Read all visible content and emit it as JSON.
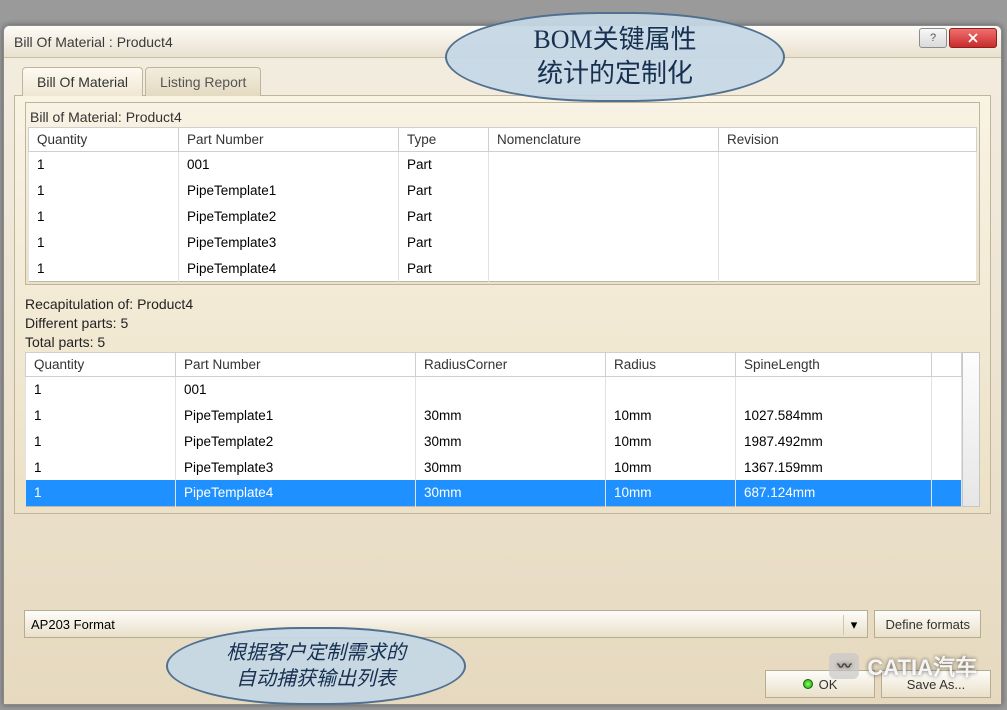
{
  "window": {
    "title": "Bill Of Material : Product4"
  },
  "tabs": {
    "bom": "Bill Of Material",
    "listing": "Listing Report"
  },
  "bom": {
    "section_title": "Bill of Material: Product4",
    "headers": {
      "qty": "Quantity",
      "part": "Part Number",
      "type": "Type",
      "nomen": "Nomenclature",
      "rev": "Revision"
    },
    "rows": [
      {
        "qty": "1",
        "part": "001",
        "type": "Part",
        "nomen": "",
        "rev": ""
      },
      {
        "qty": "1",
        "part": "PipeTemplate1",
        "type": "Part",
        "nomen": "",
        "rev": ""
      },
      {
        "qty": "1",
        "part": "PipeTemplate2",
        "type": "Part",
        "nomen": "",
        "rev": ""
      },
      {
        "qty": "1",
        "part": "PipeTemplate3",
        "type": "Part",
        "nomen": "",
        "rev": ""
      },
      {
        "qty": "1",
        "part": "PipeTemplate4",
        "type": "Part",
        "nomen": "",
        "rev": ""
      }
    ]
  },
  "recap": {
    "title": "Recapitulation of: Product4",
    "diff": "Different parts: 5",
    "total": "Total parts: 5",
    "headers": {
      "qty": "Quantity",
      "part": "Part Number",
      "rc": "RadiusCorner",
      "r": "Radius",
      "sl": "SpineLength"
    },
    "rows": [
      {
        "qty": "1",
        "part": "001",
        "rc": "",
        "r": "",
        "sl": ""
      },
      {
        "qty": "1",
        "part": "PipeTemplate1",
        "rc": "30mm",
        "r": "10mm",
        "sl": "1027.584mm"
      },
      {
        "qty": "1",
        "part": "PipeTemplate2",
        "rc": "30mm",
        "r": "10mm",
        "sl": "1987.492mm"
      },
      {
        "qty": "1",
        "part": "PipeTemplate3",
        "rc": "30mm",
        "r": "10mm",
        "sl": "1367.159mm"
      },
      {
        "qty": "1",
        "part": "PipeTemplate4",
        "rc": "30mm",
        "r": "10mm",
        "sl": "687.124mm"
      }
    ],
    "selected_index": 4
  },
  "footer": {
    "format": "AP203 Format",
    "define_formats": "Define formats",
    "ok": "OK",
    "save_as": "Save As..."
  },
  "callouts": {
    "top": "BOM关键属性\n统计的定制化",
    "bottom": "根据客户定制需求的\n自动捕获输出列表"
  },
  "watermark": "CATIA汽车"
}
